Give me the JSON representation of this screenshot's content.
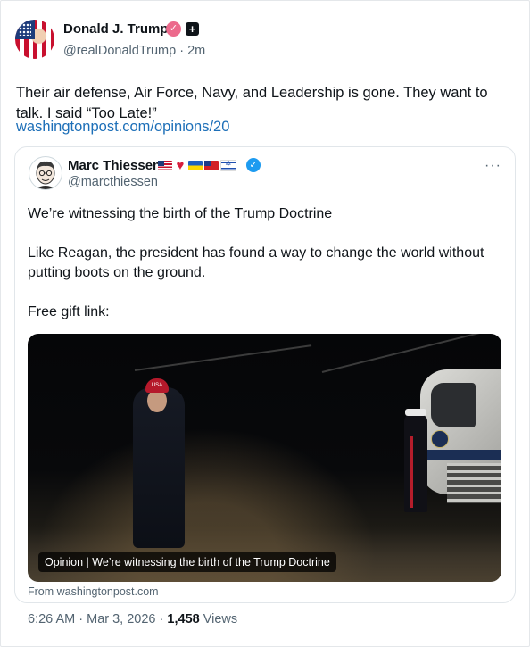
{
  "post": {
    "author_name": "Donald J. Trump",
    "handle": "@realDonaldTrump",
    "time": "2m",
    "text": "Their air defense, Air Force, Navy, and Leadership is gone. They want to talk. I said “Too Late!”",
    "link": "washingtonpost.com/opinions/20"
  },
  "quote": {
    "author_name": "Marc Thiessen",
    "handle": "@marcthiessen",
    "more": "···",
    "line1": "We’re witnessing the birth of the Trump Doctrine",
    "line2": "Like Reagan, the president has found a way to change the world without putting boots on the ground.",
    "line3": "Free gift link:",
    "image_caption": "Opinion | We’re witnessing the birth of the Trump Doctrine",
    "image_cap_text": "USA",
    "from": "From washingtonpost.com"
  },
  "meta": {
    "time": "6:26 AM",
    "date": "Mar 3, 2026",
    "views_count": "1,458",
    "views_label": "Views",
    "separator": "·"
  },
  "icons": {
    "verified": "✓",
    "badge": "✓",
    "plus": "+",
    "heart": "♥"
  }
}
